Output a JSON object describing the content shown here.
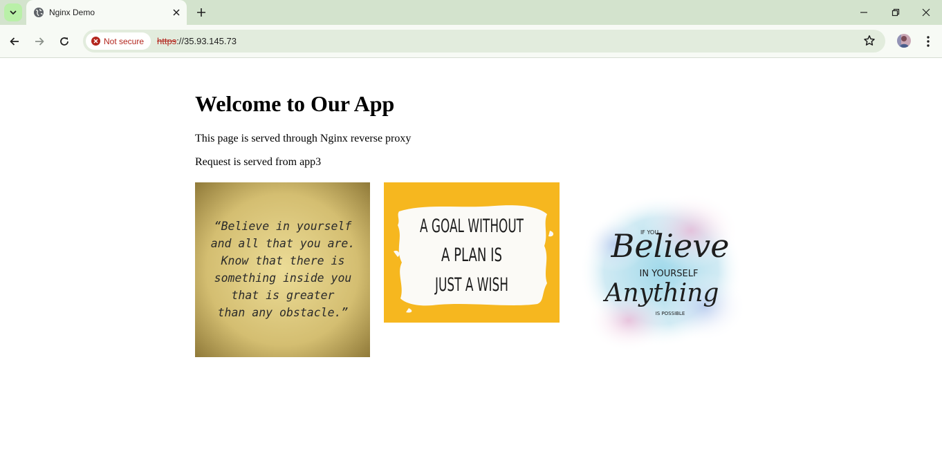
{
  "browser": {
    "tab": {
      "title": "Nginx Demo",
      "favicon": "globe-icon"
    },
    "security_chip": {
      "label": "Not secure",
      "color": "#b3261e"
    },
    "url": {
      "scheme": "https",
      "rest": "://35.93.145.73"
    }
  },
  "page": {
    "heading": "Welcome to Our App",
    "paragraphs": [
      "This page is served through Nginx reverse proxy",
      "Request is served from app3"
    ],
    "images": [
      {
        "lines": [
          "“Believe in yourself",
          "and all that you are.",
          "Know that there is",
          "something inside you",
          "that is greater",
          "than any obstacle.”"
        ]
      },
      {
        "lines": [
          "A GOAL WITHOUT",
          "A PLAN IS",
          "JUST A WISH"
        ]
      },
      {
        "small_top": "IF YOU",
        "big_top": "Believe",
        "middle": "IN YOURSELF",
        "big_bottom": "Anything",
        "small_bottom": "IS POSSIBLE"
      }
    ]
  }
}
